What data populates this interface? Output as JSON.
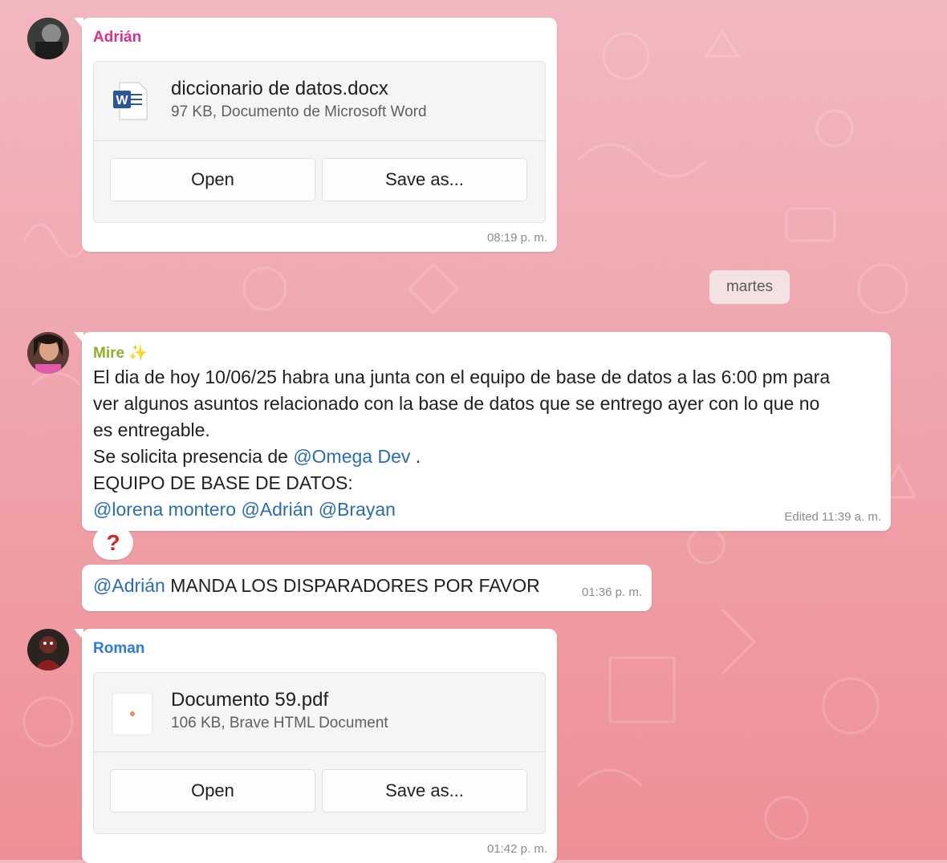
{
  "colors": {
    "adrian": "#d6338a",
    "mire": "#8ab02e",
    "roman": "#2c7bd6",
    "mention": "#2b6cb0"
  },
  "messages": {
    "adrian_file": {
      "sender": "Adrián",
      "file_name": "diccionario de datos.docx",
      "file_meta": "97 KB, Documento de Microsoft Word",
      "icon": "word-doc-icon",
      "open_label": "Open",
      "save_label": "Save as...",
      "time": "08:19 p. m."
    },
    "date_separator": "martes",
    "mire_text": {
      "sender": "Mire",
      "sender_emoji": "✨",
      "line1": "El dia de hoy 10/06/25 habra una junta con el equipo de base de datos a las 6:00 pm para",
      "line2": "ver algunos asuntos relacionado con la base de datos que se entrego ayer con lo que no",
      "line3": "es entregable.",
      "line4_prefix": "Se solicita presencia de ",
      "line4_mention": "@Omega Dev",
      "line4_suffix": " .",
      "line5": "EQUIPO DE BASE DE DATOS:",
      "mention1": "@lorena montero",
      "mention2": "@Adrián",
      "mention3": "@Brayan",
      "time": "Edited 11:39 a. m.",
      "reaction": "?"
    },
    "mire_followup": {
      "mention": "@Adrián",
      "text": " MANDA LOS DISPARADORES POR FAVOR",
      "time": "01:36 p. m."
    },
    "roman_file": {
      "sender": "Roman",
      "file_name": "Documento 59.pdf",
      "file_meta": "106 KB, Brave HTML Document",
      "icon": "pdf-doc-icon",
      "open_label": "Open",
      "save_label": "Save as...",
      "time": "01:42 p. m."
    }
  }
}
